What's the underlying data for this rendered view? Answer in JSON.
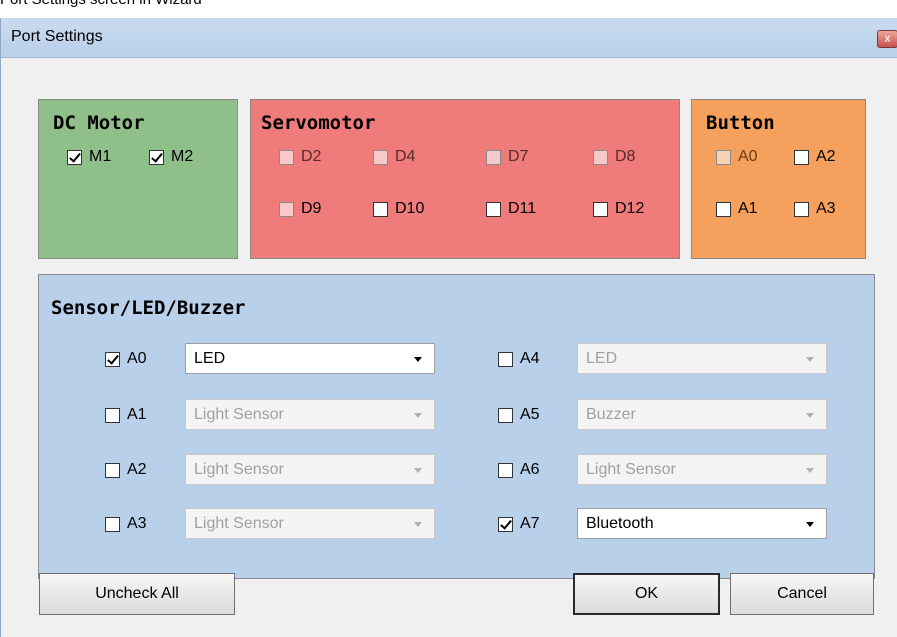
{
  "background_caption": "Port Settings screen in Wizard",
  "window": {
    "title": "Port Settings",
    "close_label": "x"
  },
  "dc_motor": {
    "title": "DC Motor",
    "ports": [
      {
        "label": "M1",
        "checked": true
      },
      {
        "label": "M2",
        "checked": true
      }
    ]
  },
  "servomotor": {
    "title": "Servomotor",
    "ports": [
      {
        "label": "D2",
        "checked": false
      },
      {
        "label": "D4",
        "checked": false
      },
      {
        "label": "D7",
        "checked": false
      },
      {
        "label": "D8",
        "checked": false
      },
      {
        "label": "D9",
        "checked": false
      },
      {
        "label": "D10",
        "checked": false
      },
      {
        "label": "D11",
        "checked": false
      },
      {
        "label": "D12",
        "checked": false
      }
    ]
  },
  "button_group": {
    "title": "Button",
    "ports": [
      {
        "label": "A0",
        "checked": false
      },
      {
        "label": "A2",
        "checked": false
      },
      {
        "label": "A1",
        "checked": false
      },
      {
        "label": "A3",
        "checked": false
      }
    ]
  },
  "sensor": {
    "title": "Sensor/LED/Buzzer",
    "ports": [
      {
        "label": "A0",
        "checked": true,
        "device": "LED"
      },
      {
        "label": "A1",
        "checked": false,
        "device": "Light Sensor"
      },
      {
        "label": "A2",
        "checked": false,
        "device": "Light Sensor"
      },
      {
        "label": "A3",
        "checked": false,
        "device": "Light Sensor"
      },
      {
        "label": "A4",
        "checked": false,
        "device": "LED"
      },
      {
        "label": "A5",
        "checked": false,
        "device": "Buzzer"
      },
      {
        "label": "A6",
        "checked": false,
        "device": "Light Sensor"
      },
      {
        "label": "A7",
        "checked": true,
        "device": "Bluetooth"
      }
    ]
  },
  "buttons": {
    "uncheck_all": "Uncheck All",
    "ok": "OK",
    "cancel": "Cancel"
  },
  "colors": {
    "dc_motor": "#90c08a",
    "servomotor": "#ef7b7b",
    "button": "#f5a05c",
    "sensor": "#b8d0ea",
    "titlebar": "#c2d6ee"
  }
}
